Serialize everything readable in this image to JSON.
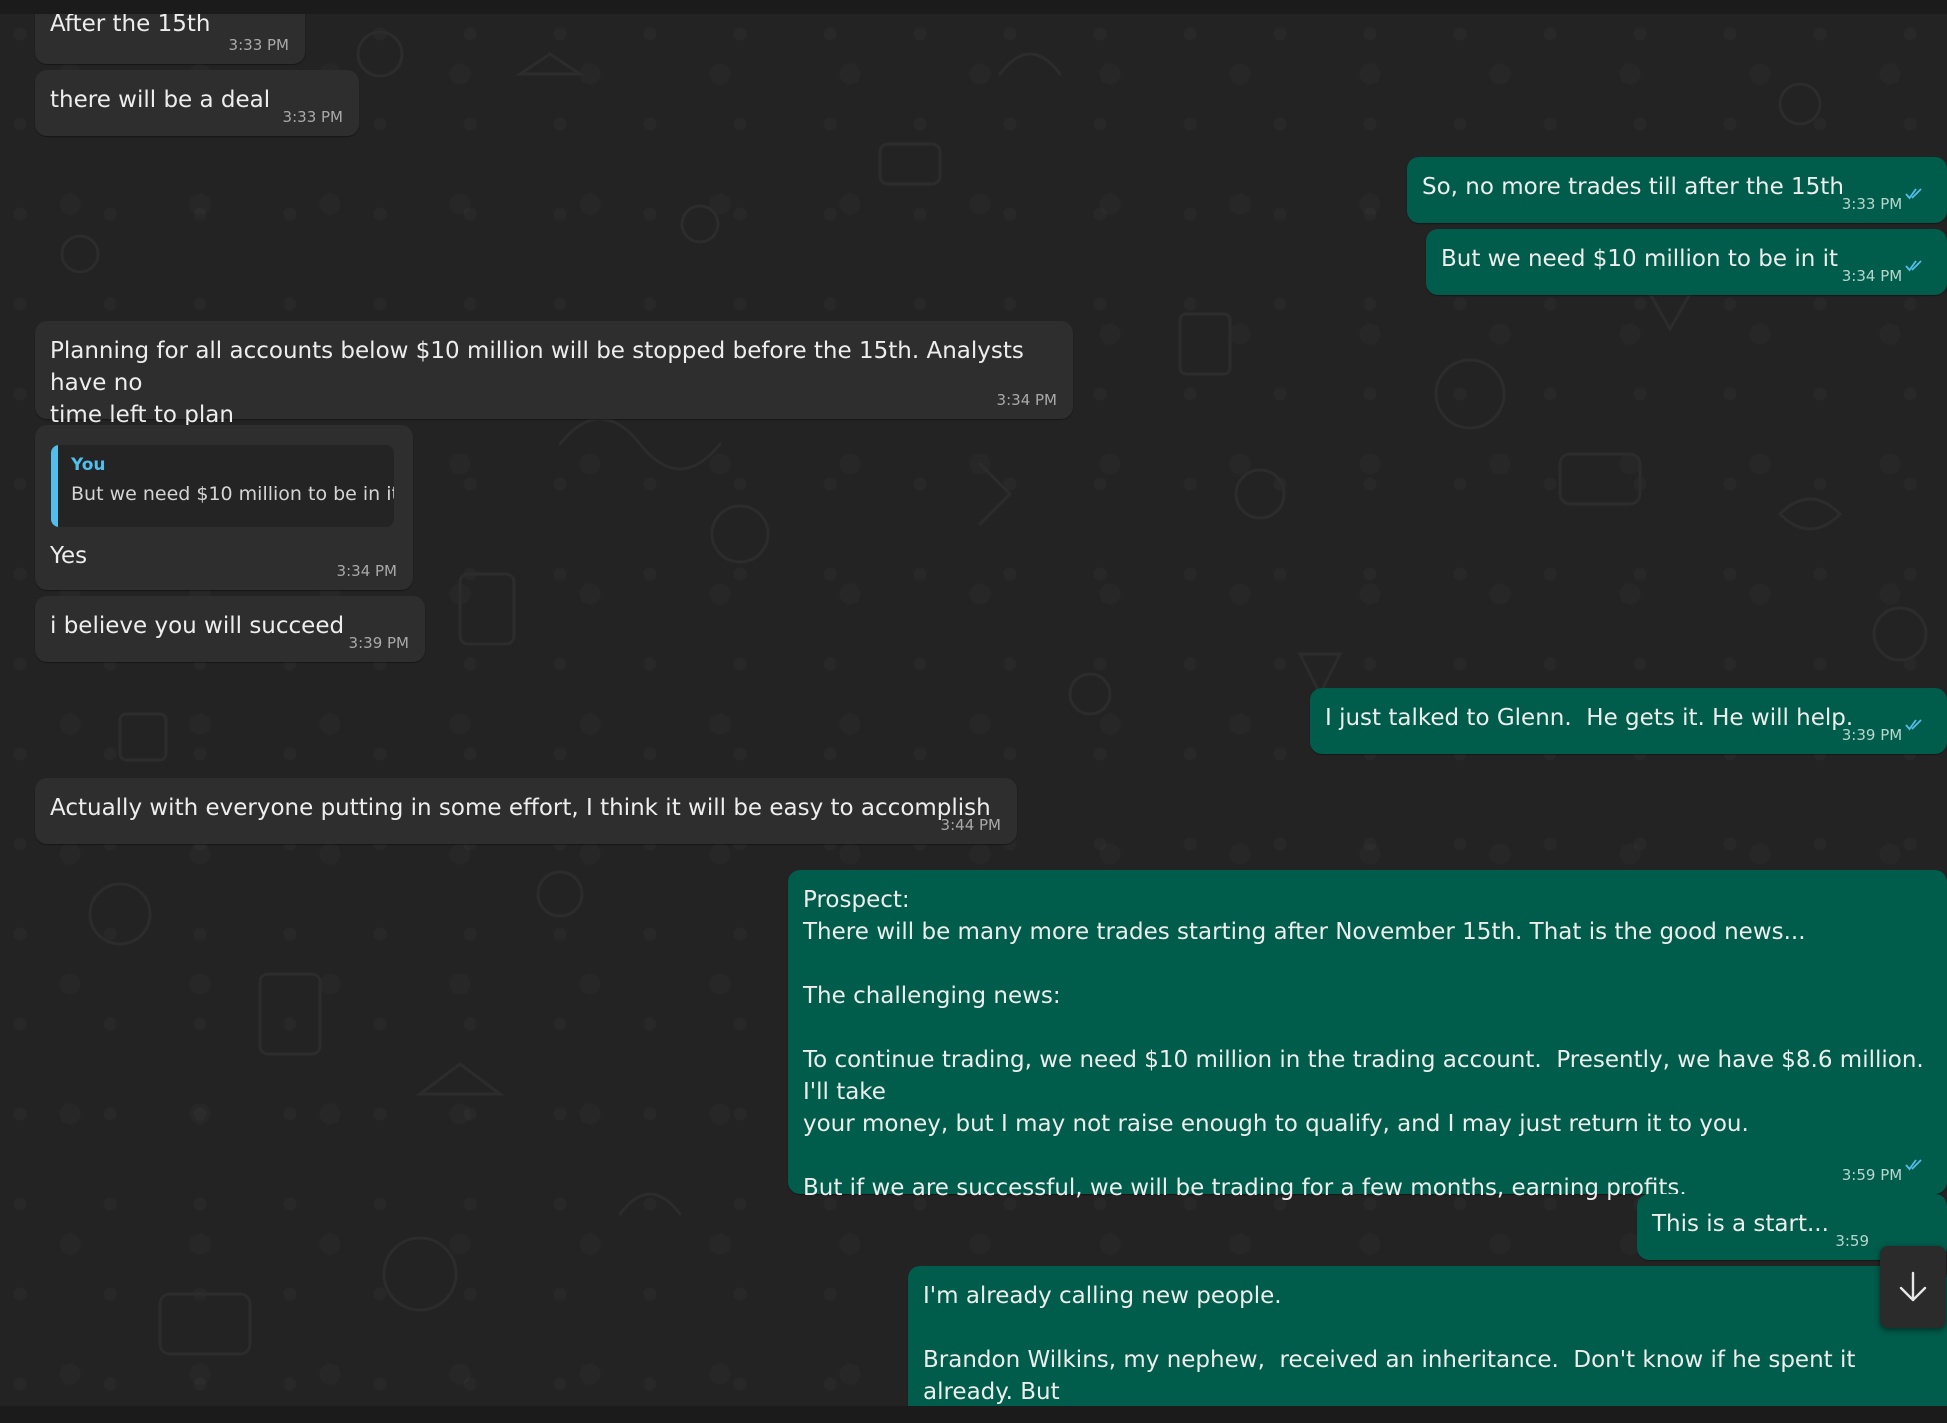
{
  "messages": [
    {
      "id": "m1",
      "direction": "incoming",
      "text": "After the 15th",
      "time": "3:33 PM"
    },
    {
      "id": "m2",
      "direction": "incoming",
      "text": "there will be a deal",
      "time": "3:33 PM"
    },
    {
      "id": "m3",
      "direction": "outgoing",
      "text": "So, no more trades till after the 15th",
      "time": "3:33 PM",
      "status_icon": "double-check-read-icon"
    },
    {
      "id": "m4",
      "direction": "outgoing",
      "text": "But we need $10 million to be in it",
      "time": "3:34 PM",
      "status_icon": "double-check-read-icon"
    },
    {
      "id": "m5",
      "direction": "incoming",
      "text": "Planning for all accounts below $10 million will be stopped before the 15th. Analysts have no\ntime left to plan",
      "time": "3:34 PM"
    },
    {
      "id": "m6",
      "direction": "incoming",
      "quoted": {
        "author": "You",
        "text": "But we need $10 million to be in it"
      },
      "text": "Yes",
      "time": "3:34 PM"
    },
    {
      "id": "m7",
      "direction": "incoming",
      "text": "i believe you will succeed",
      "time": "3:39 PM"
    },
    {
      "id": "m8",
      "direction": "outgoing",
      "text": "I just talked to Glenn.  He gets it. He will help.",
      "time": "3:39 PM",
      "status_icon": "double-check-read-icon"
    },
    {
      "id": "m9",
      "direction": "incoming",
      "text": "Actually with everyone putting in some effort, I think it will be easy to accomplish",
      "time": "3:44 PM"
    },
    {
      "id": "m10",
      "direction": "outgoing",
      "text": "Prospect:\nThere will be many more trades starting after November 15th. That is the good news...\n\nThe challenging news:\n\nTo continue trading, we need $10 million in the trading account.  Presently, we have $8.6 million. I'll take\nyour money, but I may not raise enough to qualify, and I may just return it to you.\n\nBut if we are successful, we will be trading for a few months, earning profits.",
      "time": "3:59 PM",
      "status_icon": "double-check-read-icon"
    },
    {
      "id": "m11",
      "direction": "outgoing",
      "text": "This is a start...",
      "time": "3:59"
    },
    {
      "id": "m12",
      "direction": "outgoing",
      "text": "I'm already calling new people.\n\nBrandon Wilkins, my nephew,  received an inheritance.  Don't know if he spent it already. But\nI will find out.",
      "time": ""
    }
  ],
  "scroll_button": {
    "icon": "arrow-down-icon"
  },
  "colors": {
    "incoming_bubble": "#2e2e2e",
    "outgoing_bubble": "#005c4b",
    "read_ticks": "#53bdeb",
    "quote_author": "#53bdeb",
    "chat_background": "#232323"
  }
}
